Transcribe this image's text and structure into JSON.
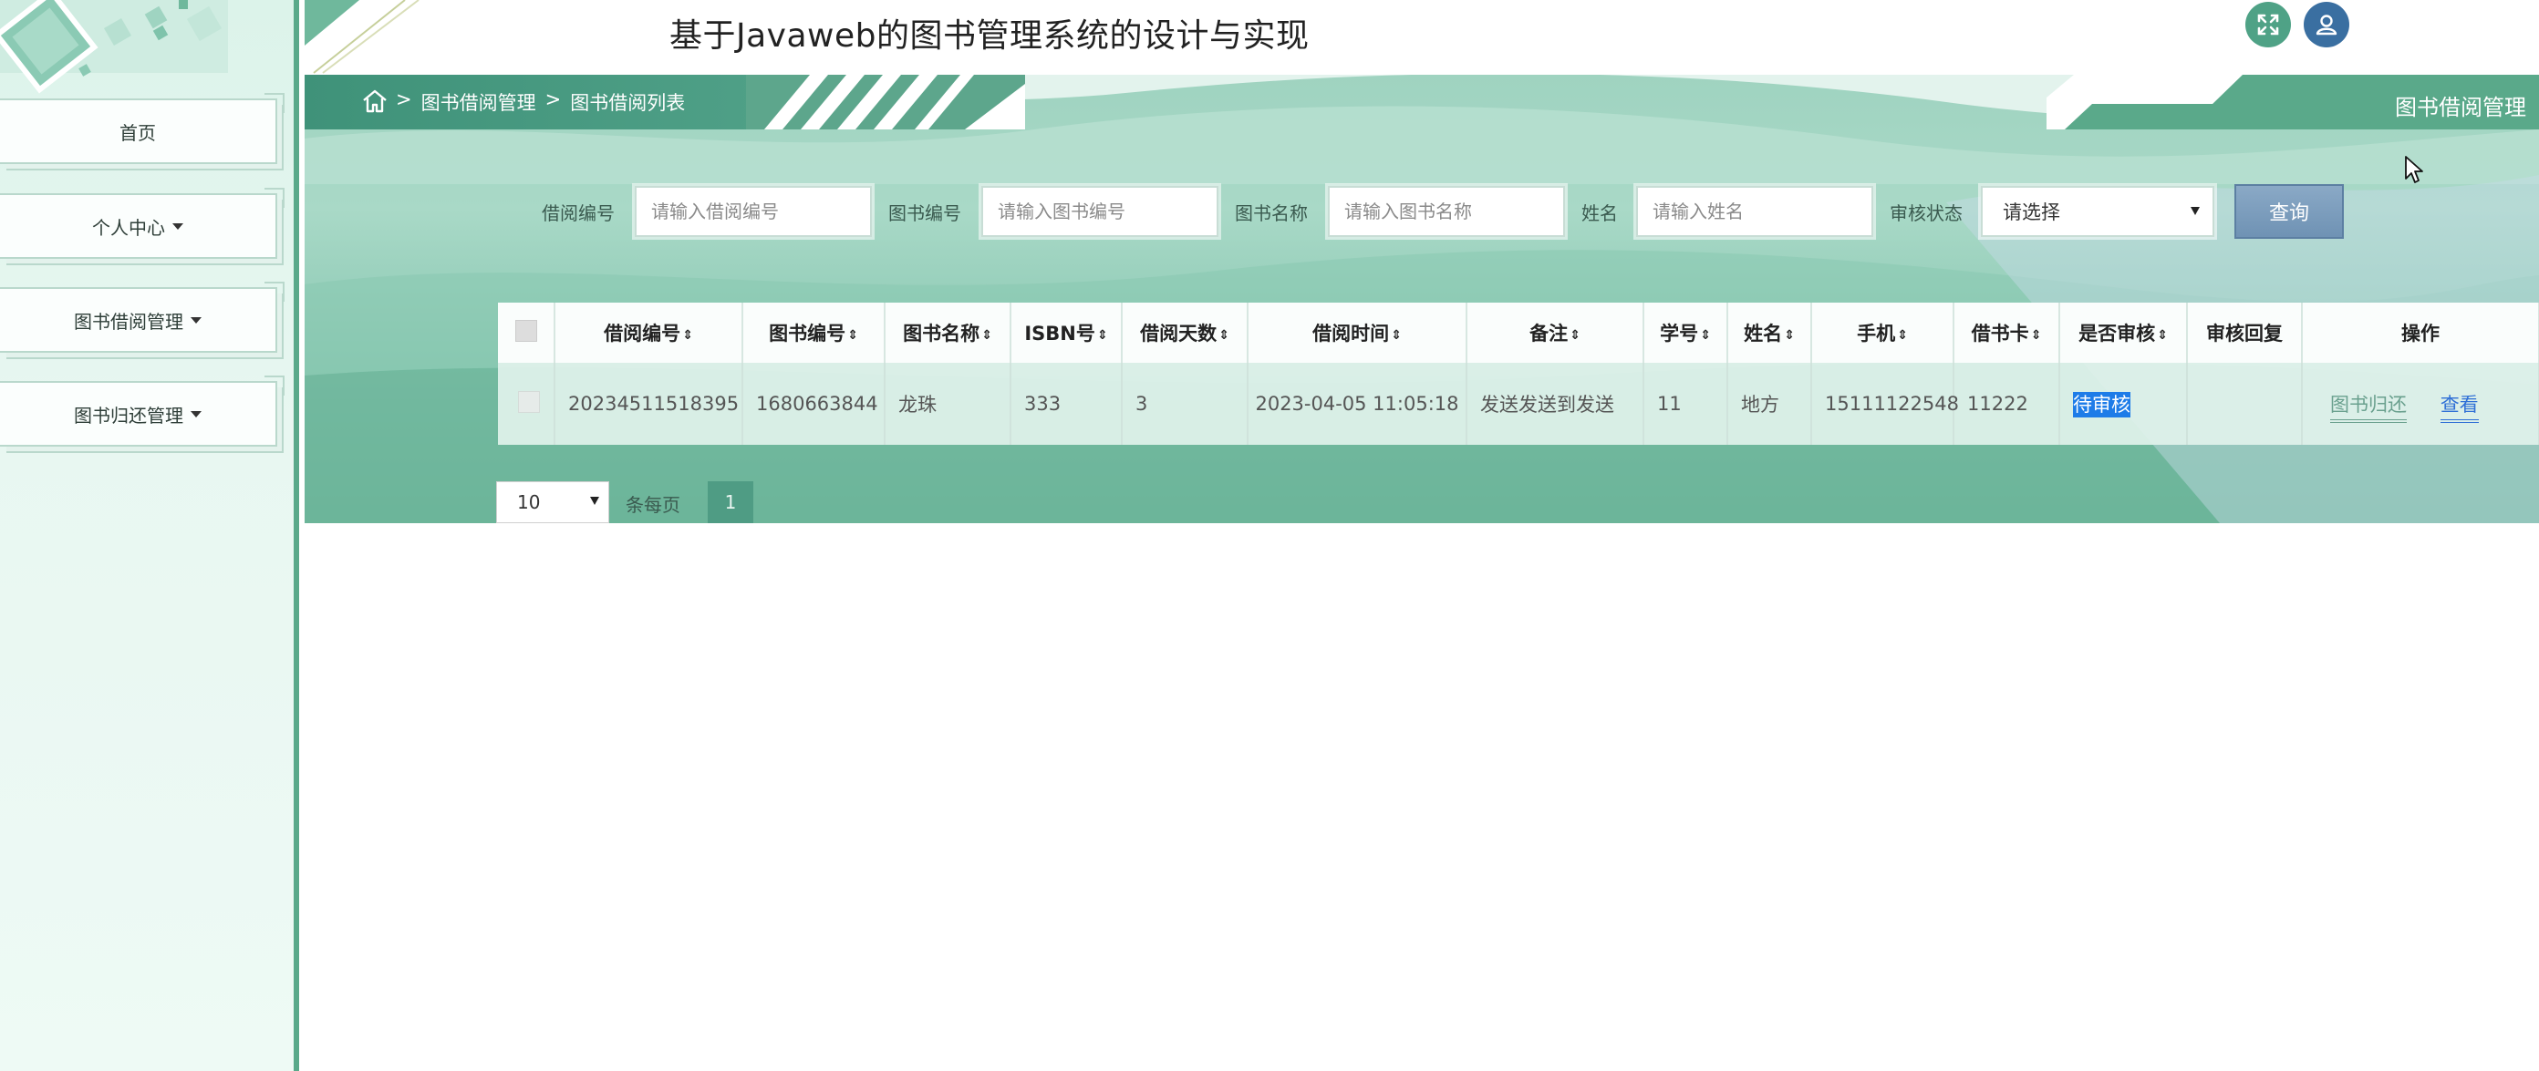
{
  "app": {
    "title": "基于Javaweb的图书管理系统的设计与实现"
  },
  "sidebar": {
    "items": [
      {
        "label": "首页",
        "has_caret": false
      },
      {
        "label": "个人中心",
        "has_caret": true
      },
      {
        "label": "图书借阅管理",
        "has_caret": true
      },
      {
        "label": "图书归还管理",
        "has_caret": true
      }
    ]
  },
  "breadcrumb": {
    "separator": ">",
    "items": [
      "图书借阅管理",
      "图书借阅列表"
    ]
  },
  "section_title": "图书借阅管理",
  "search": {
    "fields": [
      {
        "label": "借阅编号",
        "placeholder": "请输入借阅编号"
      },
      {
        "label": "图书编号",
        "placeholder": "请输入图书编号"
      },
      {
        "label": "图书名称",
        "placeholder": "请输入图书名称"
      },
      {
        "label": "姓名",
        "placeholder": "请输入姓名"
      }
    ],
    "status_label": "审核状态",
    "status_value": "请选择",
    "button_label": "查询"
  },
  "table": {
    "sort_icon": "⇕",
    "columns": [
      "借阅编号",
      "图书编号",
      "图书名称",
      "ISBN号",
      "借阅天数",
      "借阅时间",
      "备注",
      "学号",
      "姓名",
      "手机",
      "借书卡",
      "是否审核",
      "审核回复",
      "操作"
    ],
    "rows": [
      {
        "borrow_no": "20234511518395",
        "book_no": "1680663844",
        "book_name": "龙珠",
        "isbn": "333",
        "days": "3",
        "borrow_time": "2023-04-05 11:05:18",
        "remark": "发送发送到发送",
        "student_no": "11",
        "name": "地方",
        "phone": "15111122548",
        "card": "11222",
        "audit_status": "待审核",
        "audit_reply": "",
        "actions": [
          "图书归还",
          "查看"
        ]
      }
    ]
  },
  "pagination": {
    "page_size": "10",
    "page_size_label": "条每页",
    "current_page": "1"
  },
  "colors": {
    "accent": "#4f9c84",
    "selection": "#1e7ce8",
    "link_return": "#6aa08e",
    "link_view": "#2f6fd6"
  },
  "icons": [
    "fullscreen-icon",
    "user-icon",
    "home-icon"
  ]
}
